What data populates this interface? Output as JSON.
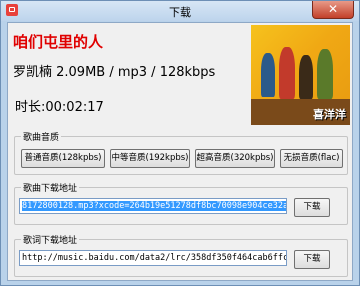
{
  "window": {
    "title": "下载",
    "close_symbol": "✕"
  },
  "song": {
    "title": "咱们屯里的人",
    "info": "罗凯楠  2.09MB / mp3 / 128kbps",
    "duration": "时长:00:02:17"
  },
  "album_art": {
    "caption": "喜洋洋"
  },
  "quality": {
    "label": "歌曲音质",
    "buttons": [
      "普通音质(128kpbs)",
      "中等音质(192kpbs)",
      "超高音质(320kpbs)",
      "无损音质(flac)"
    ]
  },
  "song_download": {
    "label": "歌曲下载地址",
    "url": "8172800128.mp3?xcode=264b19e51278df8bc70098e904ce32a9",
    "button": "下载"
  },
  "lyrics_download": {
    "label": "歌词下载地址",
    "url": "http://music.baidu.com/data2/lrc/358df350f464cab6ffcf28adb6ff",
    "button": "下载"
  }
}
